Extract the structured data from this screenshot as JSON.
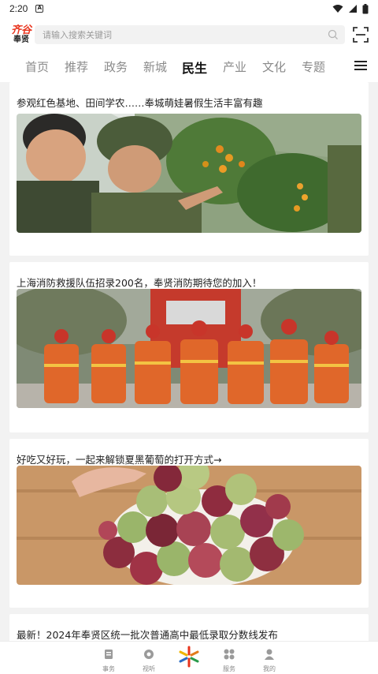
{
  "status": {
    "time": "2:20"
  },
  "header": {
    "logo_top": "齐谷",
    "logo_bottom": "奉贤",
    "search_placeholder": "请输入搜索关键词"
  },
  "tabs": [
    "首页",
    "推荐",
    "政务",
    "新城",
    "民生",
    "产业",
    "文化",
    "专题"
  ],
  "active_tab": "民生",
  "articles": [
    {
      "title": "参观红色基地、田间学农……奉城萌娃暑假生活丰富有趣"
    },
    {
      "title": "上海消防救援队伍招录200名，奉贤消防期待您的加入！"
    },
    {
      "title": "好吃又好玩，一起来解锁夏黑葡萄的打开方式→"
    },
    {
      "title": "最新！2024年奉贤区统一批次普通高中最低录取分数线发布"
    }
  ],
  "bottom_nav": [
    {
      "label": "事务",
      "icon": "document-icon"
    },
    {
      "label": "视听",
      "icon": "play-icon"
    },
    {
      "label": "",
      "icon": "center-logo-icon"
    },
    {
      "label": "服务",
      "icon": "grid-icon"
    },
    {
      "label": "我的",
      "icon": "user-icon"
    }
  ],
  "colors": {
    "brand": "#e8331c",
    "bg": "#f2f2f2"
  }
}
